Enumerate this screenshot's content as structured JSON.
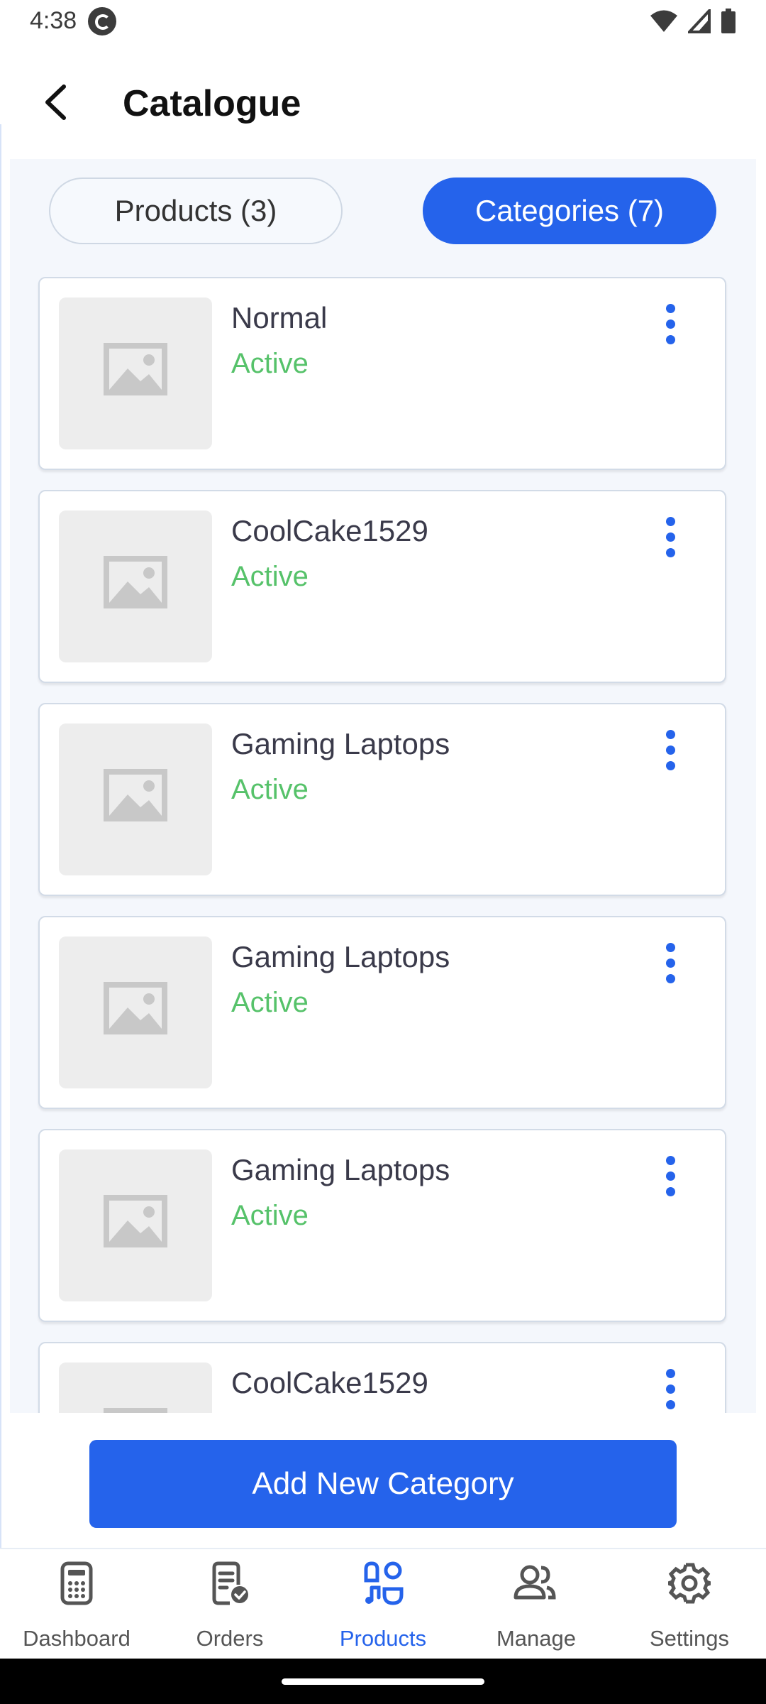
{
  "status_bar": {
    "time": "4:38"
  },
  "header": {
    "title": "Catalogue"
  },
  "tabs": [
    {
      "label": "Products (3)",
      "active": false
    },
    {
      "label": "Categories (7)",
      "active": true
    }
  ],
  "categories": [
    {
      "name": "Normal",
      "status": "Active"
    },
    {
      "name": "CoolCake1529",
      "status": "Active"
    },
    {
      "name": "Gaming Laptops",
      "status": "Active"
    },
    {
      "name": "Gaming Laptops",
      "status": "Active"
    },
    {
      "name": "Gaming Laptops",
      "status": "Active"
    },
    {
      "name": "CoolCake1529",
      "status": ""
    }
  ],
  "add_button": {
    "label": "Add New Category"
  },
  "bottom_nav": [
    {
      "label": "Dashboard",
      "icon": "calculator-icon",
      "active": false
    },
    {
      "label": "Orders",
      "icon": "orders-icon",
      "active": false
    },
    {
      "label": "Products",
      "icon": "products-icon",
      "active": true
    },
    {
      "label": "Manage",
      "icon": "users-icon",
      "active": false
    },
    {
      "label": "Settings",
      "icon": "gear-icon",
      "active": false
    }
  ],
  "colors": {
    "accent": "#2563eb",
    "status_active": "#56c26a",
    "background_soft": "#f4f7fc"
  }
}
